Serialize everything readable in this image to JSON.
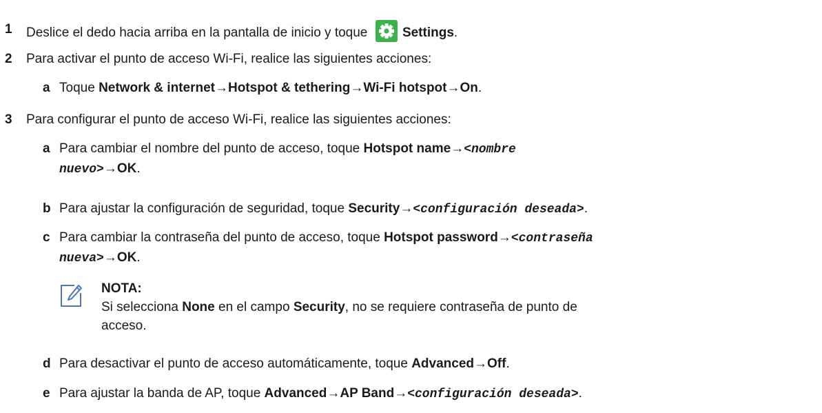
{
  "steps": [
    {
      "num": "1",
      "before": "Deslice el dedo hacia arriba en la pantalla de inicio y toque",
      "app": "Settings",
      "after": ".",
      "icon": "settings-gear-icon"
    },
    {
      "num": "2",
      "text": "Para activar el punto de acceso Wi-Fi, realice las siguientes acciones:",
      "substeps": [
        {
          "letter": "a",
          "lead": "Toque",
          "path": [
            "Network & internet",
            "Hotspot & tethering",
            "Wi-Fi hotspot",
            "On"
          ],
          "end": "."
        }
      ]
    },
    {
      "num": "3",
      "text": "Para configurar el punto de acceso Wi-Fi, realice las siguientes acciones:",
      "substeps": [
        {
          "letter": "a",
          "lead": "Para cambiar el nombre del punto de acceso, toque",
          "b1": "Hotspot name",
          "v1": "<nombre",
          "v2": "nuevo>",
          "b2": "OK",
          "end": "."
        },
        {
          "letter": "b",
          "lead": "Para ajustar la configuración de seguridad, toque",
          "b1": "Security",
          "v1": "<configuración deseada>",
          "end": "."
        },
        {
          "letter": "c",
          "lead": "Para cambiar la contraseña del punto de acceso, toque",
          "b1": "Hotspot password",
          "v1": "<contraseña",
          "v2": "nueva>",
          "b2": "OK",
          "end": "."
        },
        {
          "letter": "d",
          "lead": "Para desactivar el punto de acceso automáticamente, toque",
          "b1": "Advanced",
          "b2": "Off",
          "end": "."
        },
        {
          "letter": "e",
          "lead": "Para ajustar la banda de AP, toque",
          "b1": "Advanced",
          "b2": "AP Band",
          "v1": "<configuración deseada>",
          "end": "."
        }
      ]
    }
  ],
  "note": {
    "title": "NOTA:",
    "t1": "Si selecciona",
    "b1": "None",
    "t2": "en el campo",
    "b2": "Security",
    "t3": ", no se requiere contraseña de punto de",
    "t4": "acceso.",
    "icon": "pencil-note-icon"
  },
  "arrow": "→",
  "colors": {
    "gear_bg": "#3cb34a",
    "text": "#1a1a1a",
    "note_icon": "#4a78b5"
  }
}
